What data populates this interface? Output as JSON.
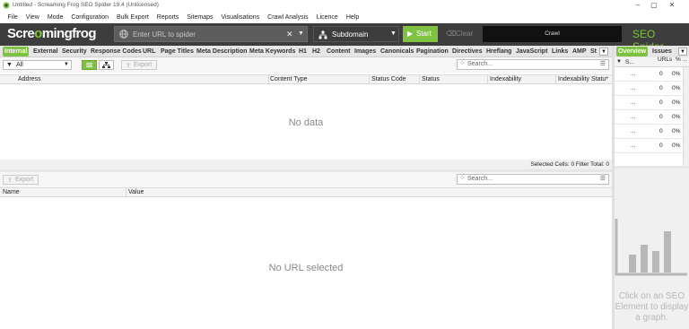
{
  "window": {
    "title": "Untitled - Screaming Frog SEO Spider 19.4 (Unlicensed)",
    "controls": [
      "–",
      "▢",
      "✕"
    ]
  },
  "menu": [
    "File",
    "View",
    "Mode",
    "Configuration",
    "Bulk Export",
    "Reports",
    "Sitemaps",
    "Visualisations",
    "Crawl Analysis",
    "Licence",
    "Help"
  ],
  "toolbar": {
    "brand_a": "Scre",
    "brand_b": "o",
    "brand_c": "mingfrog",
    "url_placeholder": "Enter URL to spider",
    "mode": "Subdomain",
    "start": "Start",
    "clear": "Clear",
    "crawl": "Crawl",
    "product": "SEO Spider"
  },
  "tabs": [
    "Internal",
    "External",
    "Security",
    "Response Codes",
    "URL",
    "Page Titles",
    "Meta Description",
    "Meta Keywords",
    "H1",
    "H2",
    "Content",
    "Images",
    "Canonicals",
    "Pagination",
    "Directives",
    "Hreflang",
    "JavaScript",
    "Links",
    "AMP",
    "St"
  ],
  "active_tab": "Internal",
  "filter": {
    "value": "All",
    "export": "Export",
    "search_placeholder": "Search..."
  },
  "table": {
    "columns": [
      "Address",
      "Content Type",
      "Status Code",
      "Status",
      "Indexability",
      "Indexability Statu"
    ],
    "empty": "No data",
    "status": "Selected Cells:  0  Filter Total:  0"
  },
  "details": {
    "export": "Export",
    "search_placeholder": "Search...",
    "columns": [
      "Name",
      "Value"
    ],
    "empty": "No URL selected"
  },
  "right_panel": {
    "tabs": [
      "Overview",
      "Issues"
    ],
    "active_tab": "Overview",
    "header": {
      "name": "S...",
      "urls": "URLs",
      "pct": "% ..."
    },
    "rows": [
      {
        "name": "...",
        "urls": "0",
        "pct": "0%"
      },
      {
        "name": "...",
        "urls": "0",
        "pct": "0%"
      },
      {
        "name": "...",
        "urls": "0",
        "pct": "0%"
      },
      {
        "name": "...",
        "urls": "0",
        "pct": "0%"
      },
      {
        "name": "...",
        "urls": "0",
        "pct": "0%"
      },
      {
        "name": "...",
        "urls": "0",
        "pct": "0%"
      }
    ],
    "chart_message": "Click on an SEO Element to display a graph."
  },
  "colors": {
    "accent": "#7fc241",
    "toolbar_bg": "#3d3d3d"
  }
}
